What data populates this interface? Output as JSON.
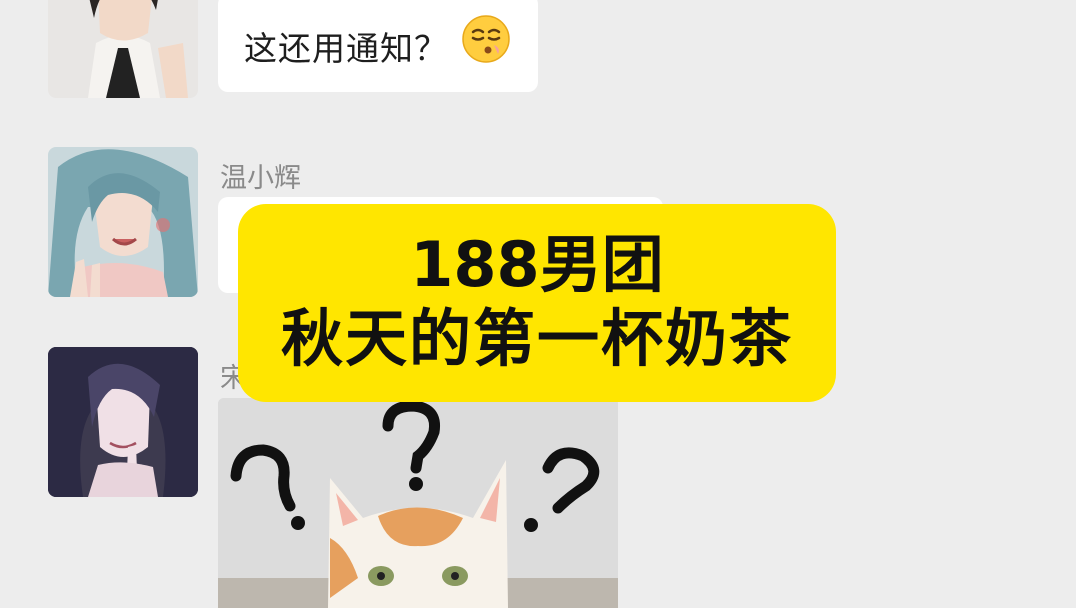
{
  "chat": {
    "messages": [
      {
        "id": "m1",
        "sender": "",
        "text": "这还用通知？",
        "emoji": "smirk-face-emoji"
      },
      {
        "id": "m2",
        "sender": "温小辉",
        "text": ""
      },
      {
        "id": "m3",
        "sender": "宋",
        "sticker": "confused-cat-question-marks"
      }
    ]
  },
  "overlay": {
    "line1": "188男团",
    "line2": "秋天的第一杯奶茶",
    "background": "#ffe600"
  },
  "colors": {
    "page_bg": "#ededed",
    "bubble_bg": "#ffffff",
    "sender_name": "#8a8a8a"
  }
}
